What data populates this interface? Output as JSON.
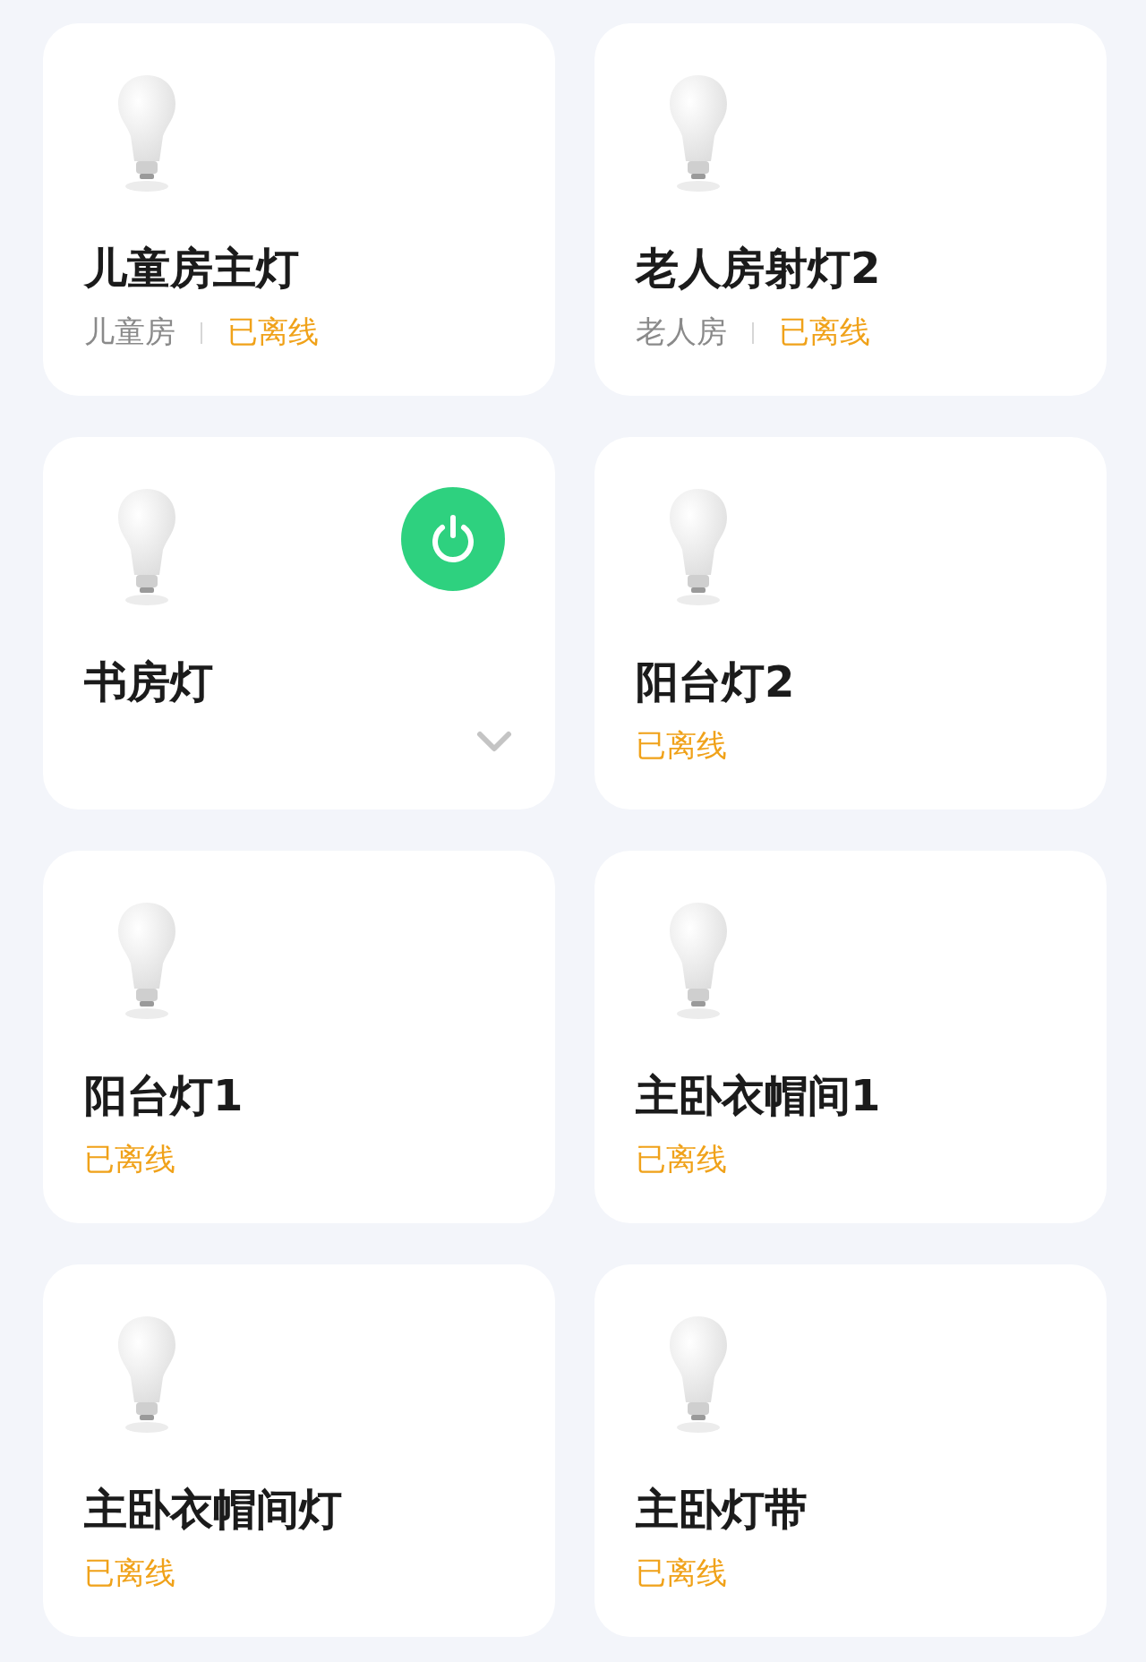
{
  "devices": [
    {
      "name": "儿童房主灯",
      "room": "儿童房",
      "online": false,
      "status": "已离线"
    },
    {
      "name": "老人房射灯2",
      "room": "老人房",
      "online": false,
      "status": "已离线"
    },
    {
      "name": "书房灯",
      "online": true,
      "powered": true
    },
    {
      "name": "阳台灯2",
      "online": false,
      "status": "已离线"
    },
    {
      "name": "阳台灯1",
      "online": false,
      "status": "已离线"
    },
    {
      "name": "主卧衣帽间1",
      "online": false,
      "status": "已离线"
    },
    {
      "name": "主卧衣帽间灯",
      "online": false,
      "status": "已离线"
    },
    {
      "name": "主卧灯带",
      "online": false,
      "status": "已离线"
    }
  ]
}
